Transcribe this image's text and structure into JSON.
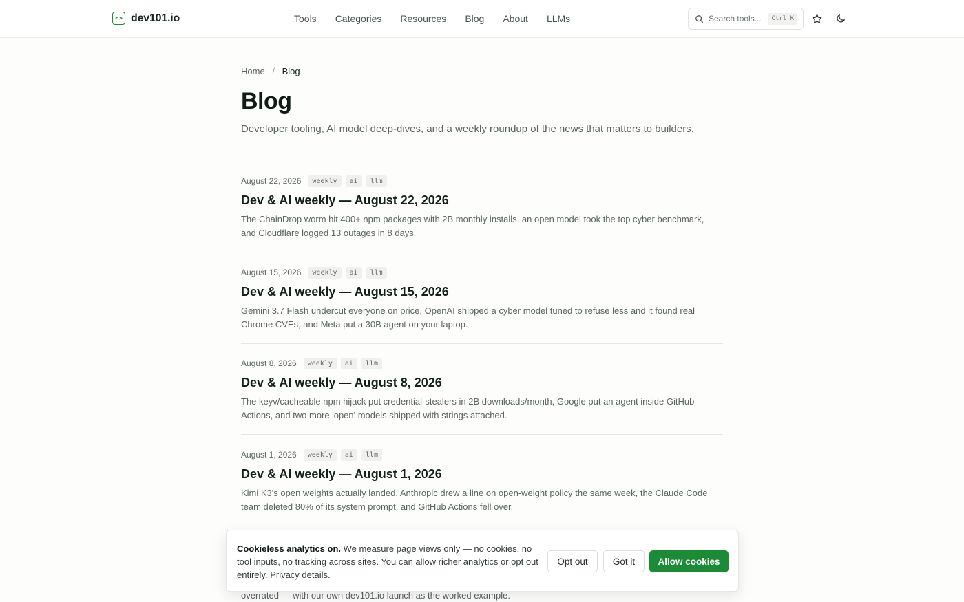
{
  "header": {
    "brand": "dev101.io",
    "nav": [
      "Tools",
      "Categories",
      "Resources",
      "Blog",
      "About",
      "LLMs"
    ],
    "search_placeholder": "Search tools...",
    "search_shortcut": "Ctrl K"
  },
  "breadcrumb": {
    "home": "Home",
    "separator": "/",
    "current": "Blog"
  },
  "page": {
    "title": "Blog",
    "description": "Developer tooling, AI model deep-dives, and a weekly roundup of the news that matters to builders."
  },
  "posts": [
    {
      "date": "August 22, 2026",
      "tags": [
        "weekly",
        "ai",
        "llm"
      ],
      "title": "Dev & AI weekly — August 22, 2026",
      "excerpt": "The ChainDrop worm hit 400+ npm packages with 2B monthly installs, an open model took the top cyber benchmark, and Cloudflare logged 13 outages in 8 days."
    },
    {
      "date": "August 15, 2026",
      "tags": [
        "weekly",
        "ai",
        "llm"
      ],
      "title": "Dev & AI weekly — August 15, 2026",
      "excerpt": "Gemini 3.7 Flash undercut everyone on price, OpenAI shipped a cyber model tuned to refuse less and it found real Chrome CVEs, and Meta put a 30B agent on your laptop."
    },
    {
      "date": "August 8, 2026",
      "tags": [
        "weekly",
        "ai",
        "llm"
      ],
      "title": "Dev & AI weekly — August 8, 2026",
      "excerpt": "The keyv/cacheable npm hijack put credential-stealers in 2B downloads/month, Google put an agent inside GitHub Actions, and two more 'open' models shipped with strings attached."
    },
    {
      "date": "August 1, 2026",
      "tags": [
        "weekly",
        "ai",
        "llm"
      ],
      "title": "Dev & AI weekly — August 1, 2026",
      "excerpt": "Kimi K3's open weights actually landed, Anthropic drew a line on open-weight policy the same week, the Claude Code team deleted 80% of its system prompt, and GitHub Actions fell over."
    }
  ],
  "partial_post_excerpt": "overrated — with our own dev101.io launch as the worked example.",
  "cookie_banner": {
    "heading": "Cookieless analytics on.",
    "text": "We measure page views only — no cookies, no tool inputs, no tracking across sites. You can allow richer analytics or opt out entirely.",
    "link": "Privacy details",
    "link_suffix": ".",
    "opt_out": "Opt out",
    "got_it": "Got it",
    "allow": "Allow cookies"
  },
  "colors": {
    "accent": "#1c8b35",
    "text": "#13211a",
    "muted": "#5a6460"
  }
}
